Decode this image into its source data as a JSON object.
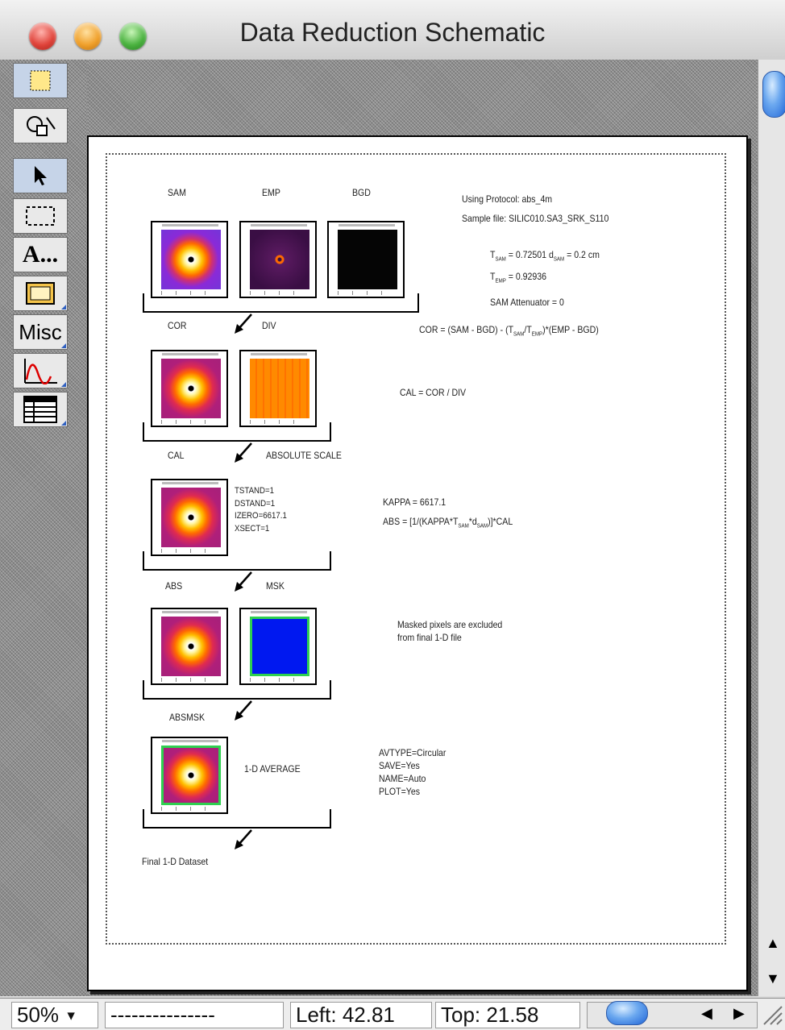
{
  "window": {
    "title": "Data Reduction Schematic",
    "colors": {
      "close": "#e0443b",
      "minimize": "#f0a12c",
      "zoom": "#4cb341",
      "accent": "#2d6fd8"
    }
  },
  "tools": [
    {
      "name": "rectangle-select-icon"
    },
    {
      "name": "shapes-icon"
    },
    {
      "name": "arrow-pointer-icon"
    },
    {
      "name": "marquee-icon"
    },
    {
      "name": "text-tool",
      "label": "A..."
    },
    {
      "name": "frame-icon"
    },
    {
      "name": "misc-tool",
      "label": "Misc"
    },
    {
      "name": "graph-icon"
    },
    {
      "name": "table-icon"
    }
  ],
  "schematic": {
    "stage1_labels": [
      "SAM",
      "EMP",
      "BGD"
    ],
    "stage2_labels": [
      "COR",
      "DIV"
    ],
    "stage3_labels": [
      "CAL",
      "ABSOLUTE SCALE"
    ],
    "stage4_labels": [
      "ABS",
      "MSK"
    ],
    "stage5_label": "ABSMSK",
    "average_label": "1-D AVERAGE",
    "final_label": "Final 1-D Dataset",
    "protocol": "Using Protocol: abs_4m",
    "sample_file": "Sample file: SILIC010.SA3_SRK_S110",
    "tsam": "T",
    "tsam_sub": "SAM",
    "tsam_val": " = 0.72501   d",
    "dsam_sub": "SAM",
    "dsam_val": " = 0.2 cm",
    "temp": "T",
    "temp_sub": "EMP",
    "temp_val": " = 0.92936",
    "attenuator": "SAM Attenuator = 0",
    "cor_formula": "COR = (SAM - BGD) - (T",
    "cor_sub1": "SAM",
    "cor_mid": "/T",
    "cor_sub2": "EMP",
    "cor_end": ")*(EMP - BGD)",
    "cal_formula": "CAL = COR / DIV",
    "stand_params": "TSTAND=1\nDSTAND=1\nIZERO=6617.1\nXSECT=1",
    "kappa": "KAPPA = 6617.1",
    "abs_formula": "ABS = [1/(KAPPA*T",
    "abs_sub1": "SAM",
    "abs_mid": "*d",
    "abs_sub2": "SAM",
    "abs_end": ")]*CAL",
    "mask_note": "Masked pixels are excluded\nfrom final 1-D file",
    "average_params": "AVTYPE=Circular\nSAVE=Yes\nNAME=Auto\nPLOT=Yes"
  },
  "status": {
    "zoom": "50%",
    "dashes": "---------------",
    "left": "Left: 42.81",
    "top": "Top: 21.58"
  }
}
